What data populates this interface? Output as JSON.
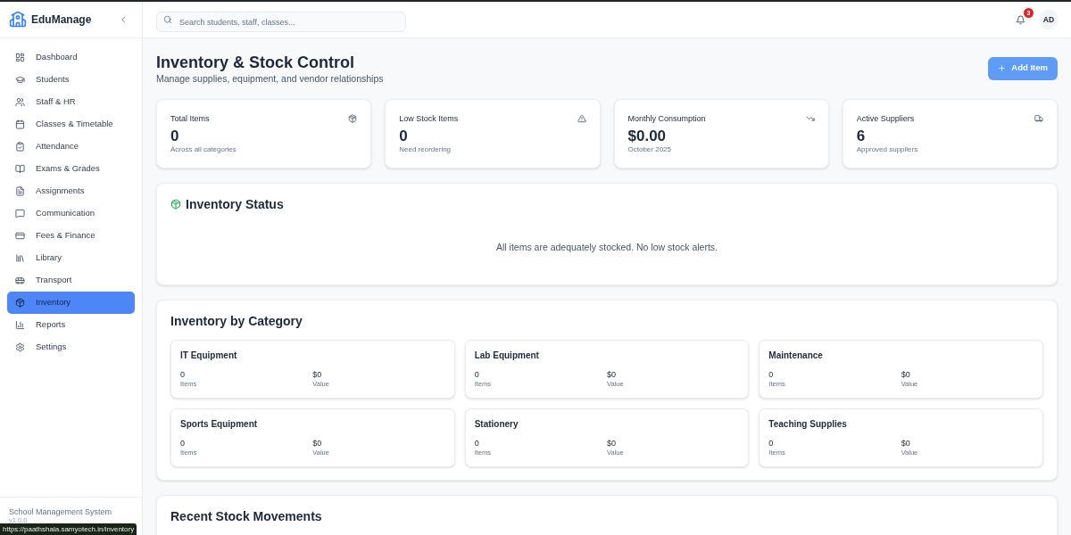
{
  "sidebar": {
    "brand": "EduManage",
    "nav": [
      {
        "label": "Dashboard",
        "selected": false
      },
      {
        "label": "Students",
        "selected": false
      },
      {
        "label": "Staff & HR",
        "selected": false
      },
      {
        "label": "Classes & Timetable",
        "selected": false
      },
      {
        "label": "Attendance",
        "selected": false
      },
      {
        "label": "Exams & Grades",
        "selected": false
      },
      {
        "label": "Assignments",
        "selected": false
      },
      {
        "label": "Communication",
        "selected": false
      },
      {
        "label": "Fees & Finance",
        "selected": false
      },
      {
        "label": "Library",
        "selected": false
      },
      {
        "label": "Transport",
        "selected": false
      },
      {
        "label": "Inventory",
        "selected": true
      },
      {
        "label": "Reports",
        "selected": false
      },
      {
        "label": "Settings",
        "selected": false
      }
    ],
    "footer": {
      "title": "School Management System",
      "version": "v1.0.0"
    }
  },
  "topbar": {
    "search": {
      "placeholder": "Search students, staff, classes..."
    },
    "notifications": {
      "count": "3"
    },
    "avatar": "AD"
  },
  "header": {
    "title": "Inventory & Stock Control",
    "subtitle": "Manage supplies, equipment, and vendor relationships",
    "action": "Add Item"
  },
  "stats": [
    {
      "label": "Total Items",
      "value": "0",
      "caption": "Across all categories"
    },
    {
      "label": "Low Stock Items",
      "value": "0",
      "caption": "Need reordering"
    },
    {
      "label": "Monthly Consumption",
      "value": "$0.00",
      "caption": "October 2025"
    },
    {
      "label": "Active Suppliers",
      "value": "6",
      "caption": "Approved suppliers"
    }
  ],
  "status_panel": {
    "title": "Inventory Status",
    "message": "All items are adequately stocked. No low stock alerts."
  },
  "category_panel": {
    "title": "Inventory by Category",
    "categories": [
      {
        "name": "IT Equipment",
        "items": "0",
        "items_label": "Items",
        "value": "$0",
        "value_label": "Value"
      },
      {
        "name": "Lab Equipment",
        "items": "0",
        "items_label": "Items",
        "value": "$0",
        "value_label": "Value"
      },
      {
        "name": "Maintenance",
        "items": "0",
        "items_label": "Items",
        "value": "$0",
        "value_label": "Value"
      },
      {
        "name": "Sports Equipment",
        "items": "0",
        "items_label": "Items",
        "value": "$0",
        "value_label": "Value"
      },
      {
        "name": "Stationery",
        "items": "0",
        "items_label": "Items",
        "value": "$0",
        "value_label": "Value"
      },
      {
        "name": "Teaching Supplies",
        "items": "0",
        "items_label": "Items",
        "value": "$0",
        "value_label": "Value"
      }
    ]
  },
  "movements_panel": {
    "title": "Recent Stock Movements"
  },
  "browser_status": {
    "url": "https://paathshala.samyotech.in/inventory"
  }
}
